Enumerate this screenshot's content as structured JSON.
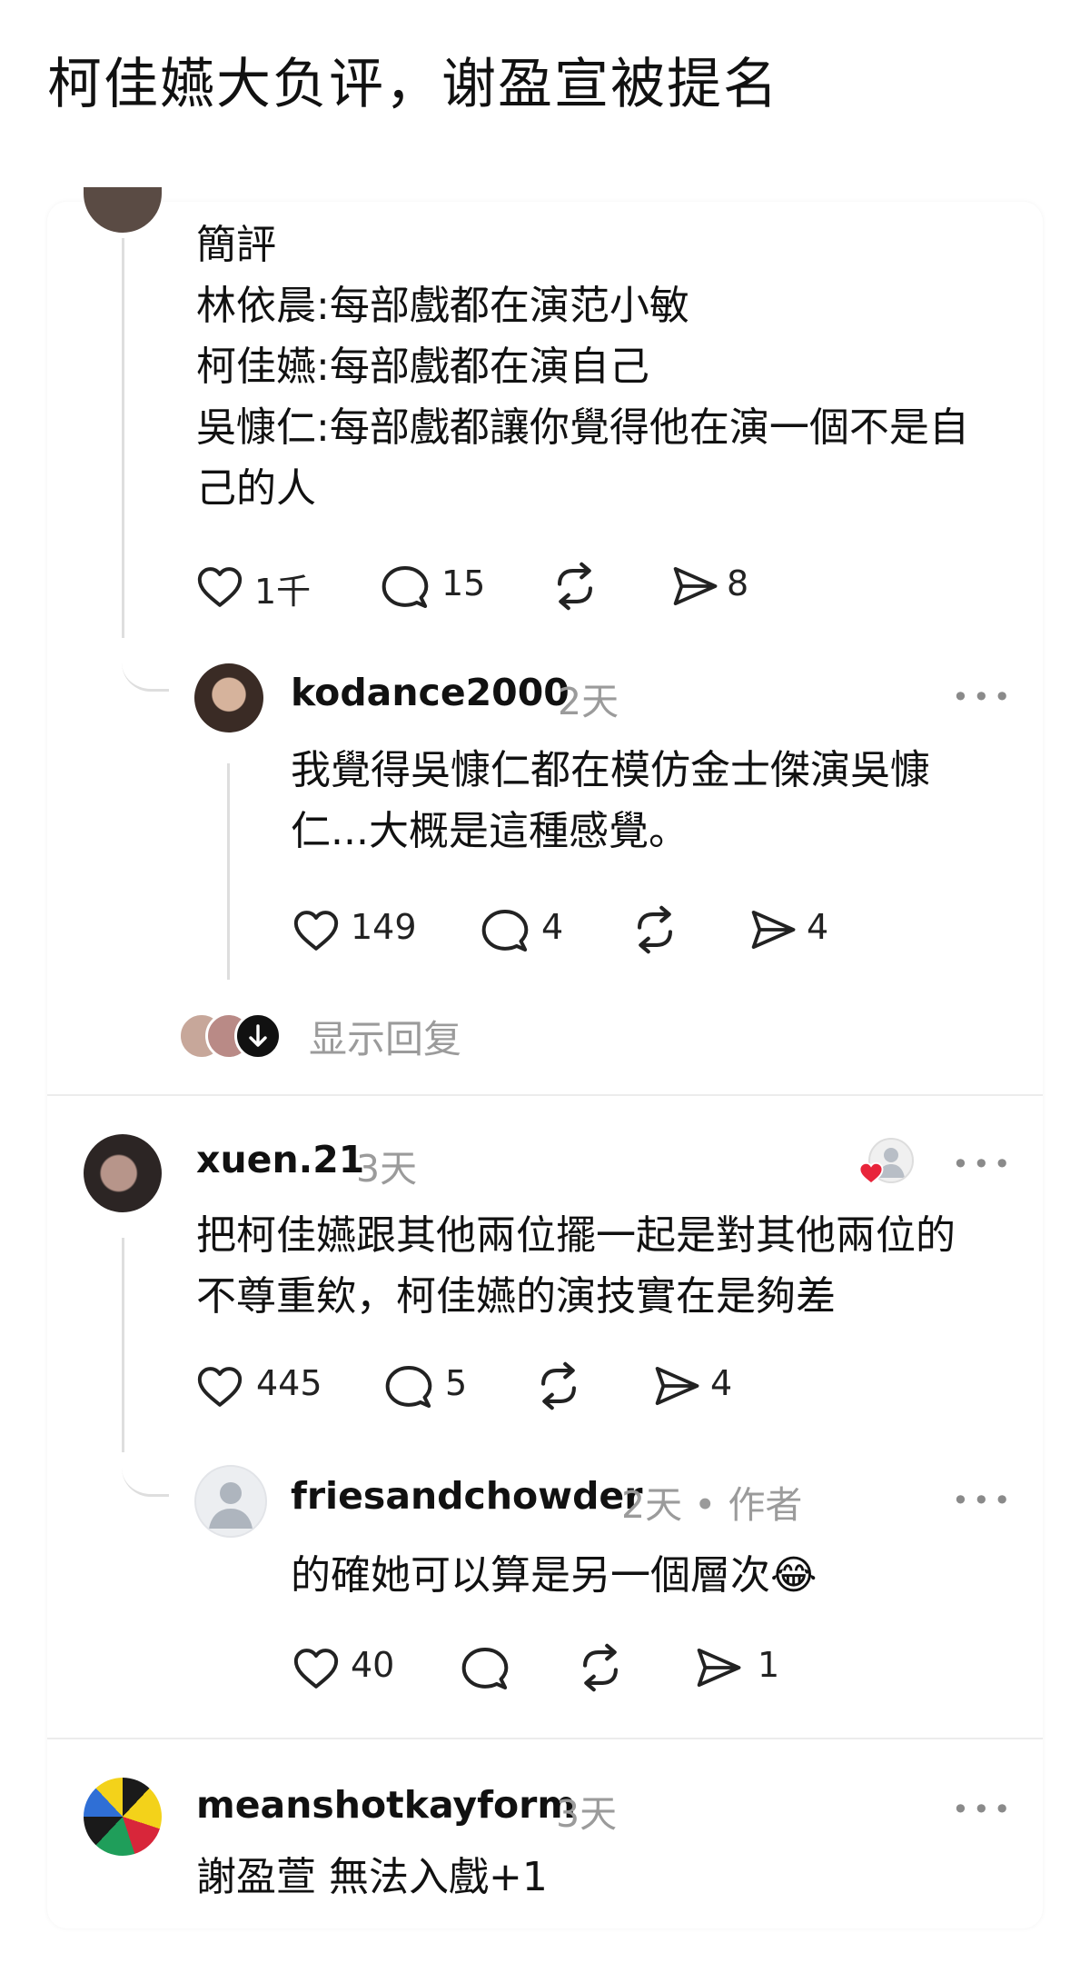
{
  "headline": "柯佳嬿大负评，谢盈宣被提名",
  "post": {
    "lines": [
      "簡評",
      "林依晨:每部戲都在演范小敏",
      "柯佳嬿:每部戲都在演自己",
      "吳慷仁:每部戲都讓你覺得他在演一個不是自",
      "己的人"
    ],
    "likes": "1千",
    "comments": "15",
    "shares": "8"
  },
  "reply1": {
    "username": "kodance2000",
    "time": "2天",
    "text": [
      "我覺得吳慷仁都在模仿金士傑演吳慷",
      "仁...大概是這種感覺。"
    ],
    "likes": "149",
    "comments": "4",
    "shares": "4"
  },
  "show_replies": "显示回复",
  "comment2": {
    "username": "xuen.21",
    "time": "3天",
    "text": [
      "把柯佳嬿跟其他兩位擺一起是對其他兩位的",
      "不尊重欸，柯佳嬿的演技實在是夠差"
    ],
    "likes": "445",
    "comments": "5",
    "shares": "4"
  },
  "reply2": {
    "username": "friesandchowder",
    "time": "2天 • 作者",
    "text": "的確她可以算是另一個層次😂",
    "likes": "40",
    "shares": "1"
  },
  "comment3": {
    "username": "meanshotkayform",
    "time": "3天",
    "text": "謝盈萱 無法入戲+1"
  },
  "more_label": "•••",
  "colors": {
    "text": "#111111",
    "muted": "#9b9b9b",
    "thread": "#dedede",
    "heart": "#e8243a"
  },
  "icons": [
    "heart-icon",
    "comment-icon",
    "repost-icon",
    "share-icon",
    "more-icon",
    "profile-placeholder-icon",
    "arrow-down-icon"
  ]
}
